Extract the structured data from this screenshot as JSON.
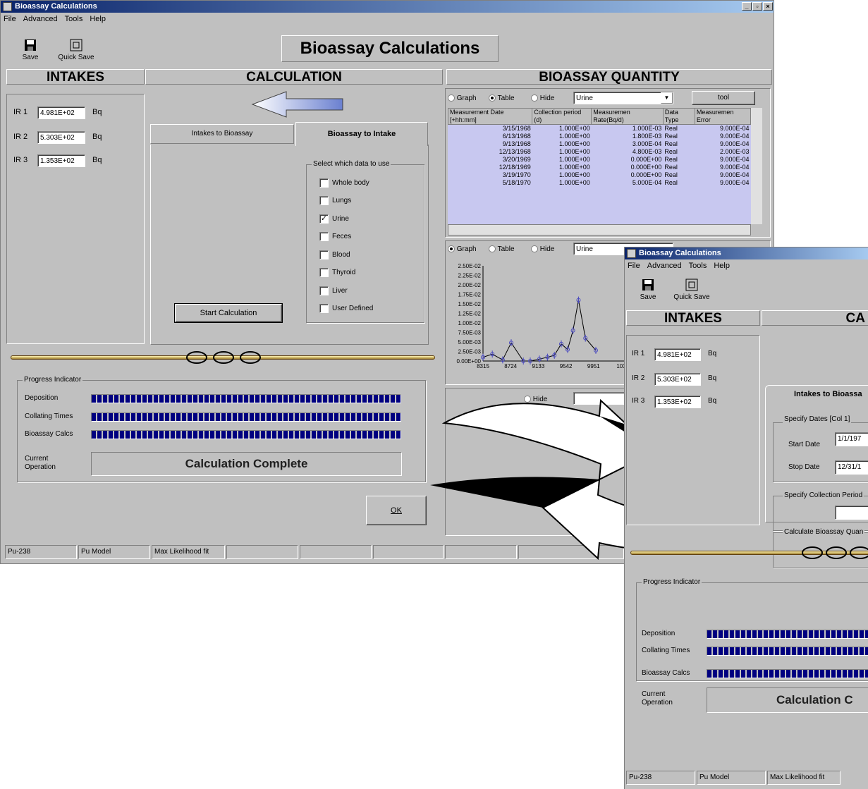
{
  "window": {
    "title": "Bioassay Calculations",
    "buttons": [
      "_",
      "▫",
      "×"
    ]
  },
  "menu": [
    "File",
    "Advanced",
    "Tools",
    "Help"
  ],
  "toolbar": {
    "save": "Save",
    "quick_save": "Quick Save"
  },
  "app_heading": "Bioassay Calculations",
  "sections": {
    "intakes": "INTAKES",
    "calculation": "CALCULATION",
    "bioassay_quantity": "BIOASSAY QUANTITY"
  },
  "intakes": [
    {
      "label": "IR 1",
      "value": "4.981E+02",
      "unit": "Bq"
    },
    {
      "label": "IR 2",
      "value": "5.303E+02",
      "unit": "Bq"
    },
    {
      "label": "IR 3",
      "value": "1.353E+02",
      "unit": "Bq"
    }
  ],
  "tabs": {
    "intakes_to_bioassay": "Intakes to Bioassay",
    "bioassay_to_intake": "Bioassay to Intake"
  },
  "select_data": {
    "title": "Select which data to use",
    "items": [
      {
        "label": "Whole body",
        "checked": false
      },
      {
        "label": "Lungs",
        "checked": false
      },
      {
        "label": "Urine",
        "checked": true
      },
      {
        "label": "Feces",
        "checked": false
      },
      {
        "label": "Blood",
        "checked": false
      },
      {
        "label": "Thyroid",
        "checked": false
      },
      {
        "label": "Liver",
        "checked": false
      },
      {
        "label": "User Defined",
        "checked": false
      }
    ]
  },
  "start_calculation": "Start Calculation",
  "view_options": {
    "graph": "Graph",
    "table": "Table",
    "hide": "Hide",
    "tool": "tool"
  },
  "panel1": {
    "mode": "Table",
    "source": "Urine"
  },
  "panel2": {
    "mode": "Graph",
    "source": "Urine"
  },
  "panel3": {
    "hide": "Hide"
  },
  "table": {
    "headers": [
      "Measurement Date [+hh:mm]",
      "Collection period (d)",
      "Measuremen Rate(Bq/d)",
      "Data Type",
      "Measuremen Error"
    ],
    "rows": [
      [
        "3/15/1968",
        "1.000E+00",
        "1.000E-03",
        "Real",
        "9.000E-04"
      ],
      [
        "6/13/1968",
        "1.000E+00",
        "1.800E-03",
        "Real",
        "9.000E-04"
      ],
      [
        "9/13/1968",
        "1.000E+00",
        "3.000E-04",
        "Real",
        "9.000E-04"
      ],
      [
        "12/13/1968",
        "1.000E+00",
        "4.800E-03",
        "Real",
        "2.000E-03"
      ],
      [
        "3/20/1969",
        "1.000E+00",
        "0.000E+00",
        "Real",
        "9.000E-04"
      ],
      [
        "12/18/1969",
        "1.000E+00",
        "0.000E+00",
        "Real",
        "9.000E-04"
      ],
      [
        "3/19/1970",
        "1.000E+00",
        "0.000E+00",
        "Real",
        "9.000E-04"
      ],
      [
        "5/18/1970",
        "1.000E+00",
        "5.000E-04",
        "Real",
        "9.000E-04"
      ]
    ]
  },
  "chart_data": {
    "type": "line",
    "y_tick_labels": [
      "2.50E-02",
      "2.25E-02",
      "2.00E-02",
      "1.75E-02",
      "1.50E-02",
      "1.25E-02",
      "1.00E-02",
      "7.50E-03",
      "5.00E-03",
      "2.50E-03",
      "0.00E+00"
    ],
    "x_tick_labels": [
      "8315",
      "8724",
      "9133",
      "9542",
      "9951",
      "103"
    ],
    "ylim": [
      0,
      0.025
    ],
    "x": [
      8315,
      8450,
      8600,
      8724,
      8900,
      9000,
      9133,
      9250,
      9350,
      9450,
      9542,
      9620,
      9700,
      9800,
      9951
    ],
    "y": [
      0.001,
      0.0018,
      0.0003,
      0.0048,
      0.0,
      0.0,
      0.0005,
      0.001,
      0.0015,
      0.0045,
      0.003,
      0.008,
      0.016,
      0.006,
      0.0028
    ],
    "color": "#4b4bbf"
  },
  "progress": {
    "title": "Progress Indicator",
    "items": [
      {
        "label": "Deposition",
        "value": 1.0
      },
      {
        "label": "Collating Times",
        "value": 1.0
      },
      {
        "label": "Bioassay Calcs",
        "value": 1.0
      }
    ],
    "current_label": "Current Operation",
    "current_value": "Calculation Complete"
  },
  "ok": "OK",
  "statusbar": [
    "Pu-238",
    "Pu Model",
    "Max Likelihood fit"
  ],
  "second_window": {
    "title": "Bioassay Calculations",
    "tab": "Intakes to Bioassa",
    "specify_dates": "Specify Dates [Col 1]",
    "start_date_label": "Start Date",
    "start_date": "1/1/197",
    "stop_date_label": "Stop Date",
    "stop_date": "12/31/1",
    "collection_period": "Specify Collection Period",
    "calc_quantity": "Calculate Bioassay Quan",
    "calc_label": "CA",
    "current_value": "Calculation C"
  },
  "colors": {
    "face": "#c0c0c0",
    "title_dark": "#0a246a",
    "title_light": "#a6caf0",
    "progress": "#000080",
    "table_sel": "#c8c8f0"
  }
}
